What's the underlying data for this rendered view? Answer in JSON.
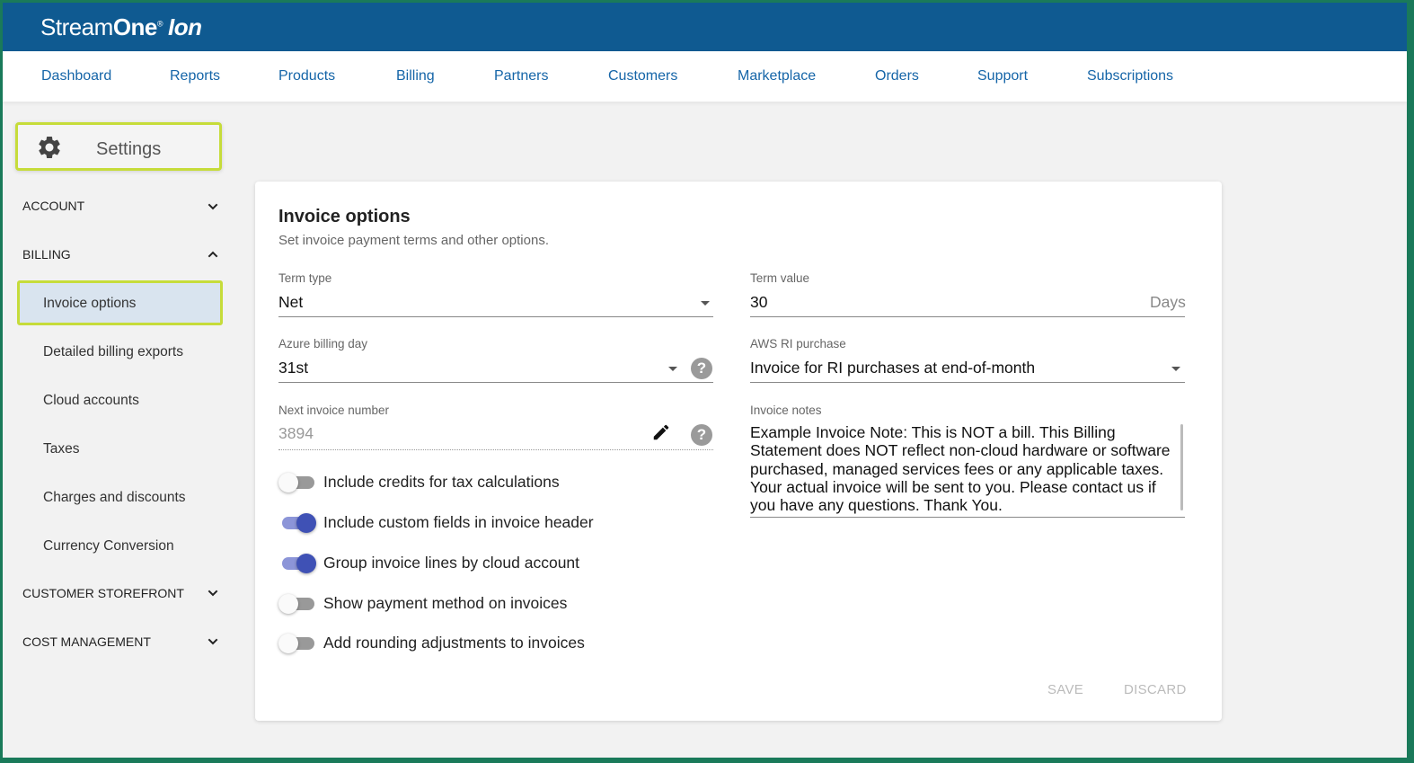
{
  "brand": {
    "stream": "Stream",
    "one": "One",
    "reg": "®",
    "ion": "Ion"
  },
  "nav": [
    "Dashboard",
    "Reports",
    "Products",
    "Billing",
    "Partners",
    "Customers",
    "Marketplace",
    "Orders",
    "Support",
    "Subscriptions"
  ],
  "sidebar": {
    "settings_label": "Settings",
    "account": "ACCOUNT",
    "billing": "BILLING",
    "billing_items": [
      "Invoice options",
      "Detailed billing exports",
      "Cloud accounts",
      "Taxes",
      "Charges and discounts",
      "Currency Conversion"
    ],
    "customer_storefront": "CUSTOMER STOREFRONT",
    "cost_management": "COST MANAGEMENT"
  },
  "card": {
    "title": "Invoice options",
    "subtitle": "Set invoice payment terms and other options.",
    "term_type": {
      "label": "Term type",
      "value": "Net"
    },
    "term_value": {
      "label": "Term value",
      "value": "30",
      "suffix": "Days"
    },
    "azure_billing_day": {
      "label": "Azure billing day",
      "value": "31st"
    },
    "aws_ri_purchase": {
      "label": "AWS RI purchase",
      "value": "Invoice for RI purchases at end-of-month"
    },
    "next_invoice_number": {
      "label": "Next invoice number",
      "value": "3894"
    },
    "invoice_notes": {
      "label": "Invoice notes",
      "value": "Example Invoice Note:  This is NOT a bill.  This Billing Statement does NOT reflect non-cloud hardware or software purchased, managed services fees or any applicable taxes.  Your actual invoice will be sent to you.  Please contact us if you have any questions.  Thank You."
    },
    "toggles": [
      {
        "label": "Include credits for tax calculations",
        "on": false
      },
      {
        "label": "Include custom fields in invoice header",
        "on": true
      },
      {
        "label": "Group invoice lines by cloud account",
        "on": true
      },
      {
        "label": "Show payment method on invoices",
        "on": false
      },
      {
        "label": "Add rounding adjustments to invoices",
        "on": false
      }
    ],
    "save_label": "SAVE",
    "discard_label": "DISCARD"
  },
  "colors": {
    "header": "#0f5a91",
    "link": "#1565a8",
    "highlight": "#c6dc3a",
    "toggle_on": "#3f51b5"
  }
}
